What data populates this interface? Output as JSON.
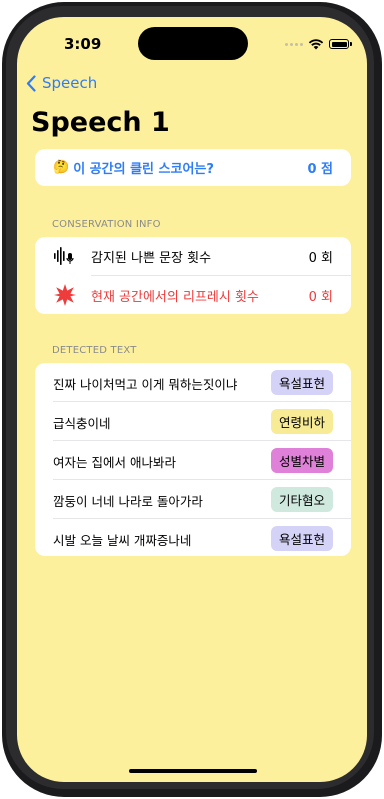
{
  "status": {
    "time": "3:09"
  },
  "nav": {
    "back_label": "Speech"
  },
  "title": "Speech 1",
  "score": {
    "emoji": "🤔",
    "question": "이 공간의 클린 스코어는?",
    "value": "0 점"
  },
  "conservation": {
    "header": "CONSERVATION INFO",
    "rows": [
      {
        "icon": "waveform-mic-icon",
        "label": "감지된 나쁜 문장 횟수",
        "value": "0 회"
      },
      {
        "icon": "burst-icon",
        "label": "현재 공간에서의 리프레시 횟수",
        "value": "0 회"
      }
    ],
    "colors": {
      "alert": "#ee3b3b"
    }
  },
  "detected": {
    "header": "DETECTED TEXT",
    "rows": [
      {
        "text": "진짜 나이처먹고 이게 뭐하는짓이냐",
        "tag": "욕설표현",
        "tag_color": "#d4d2f7"
      },
      {
        "text": "급식충이네",
        "tag": "연령비하",
        "tag_color": "#f7ec95"
      },
      {
        "text": "여자는 집에서 애나봐라",
        "tag": "성별차별",
        "tag_color": "#df81d8"
      },
      {
        "text": "깜둥이 너네 나라로 돌아가라",
        "tag": "기타혐오",
        "tag_color": "#cfe9df"
      },
      {
        "text": "시발 오늘 날씨 개짜증나네",
        "tag": "욕설표현",
        "tag_color": "#d4d2f7"
      }
    ]
  },
  "colors": {
    "accent": "#2f7df6",
    "background": "#fdf09d"
  }
}
